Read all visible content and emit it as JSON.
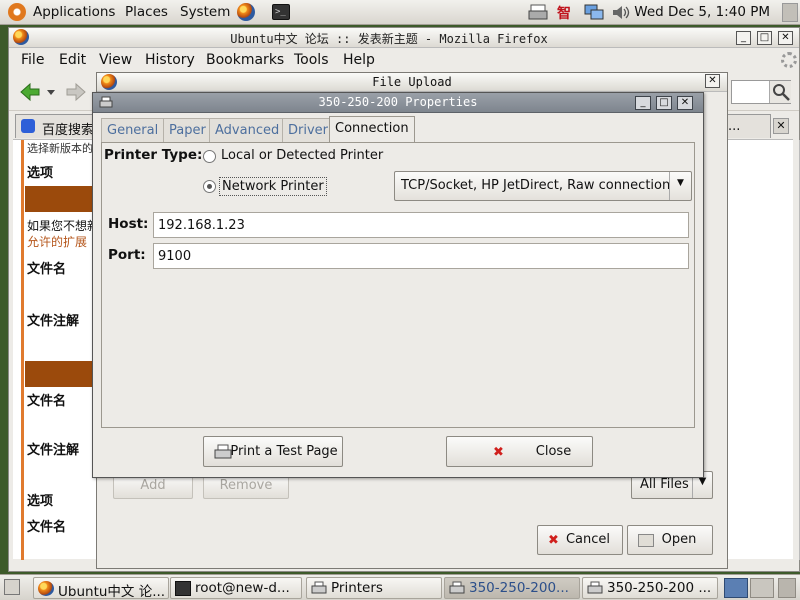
{
  "top_panel": {
    "menus": [
      "Applications",
      "Places",
      "System"
    ],
    "clock": "Wed Dec  5,  1:40 PM",
    "tray_cjk_label": "智"
  },
  "firefox": {
    "title": "Ubuntu中文 论坛 :: 发表新主题 - Mozilla Firefox",
    "menu": [
      "File",
      "Edit",
      "View",
      "History",
      "Bookmarks",
      "Tools",
      "Help"
    ],
    "tab_label": "百度搜索",
    "tab_more": "...",
    "content": {
      "line1": "选择新版本的",
      "row_xuanxiang": "选项",
      "note_line1": "如果您不想新",
      "note_line2": "允许的扩展",
      "filename": "文件名",
      "file_comment": "文件注解",
      "filename2": "文件名",
      "file_comment2": "文件注解",
      "row_xuanxiang2": "选项",
      "filename3": "文件名"
    }
  },
  "file_upload": {
    "title": "File Upload",
    "add_button": "Add",
    "remove_button": "Remove",
    "filter": "All Files",
    "cancel_button": "Cancel",
    "open_button": "Open"
  },
  "properties": {
    "title": "350-250-200 Properties",
    "tabs": [
      "General",
      "Paper",
      "Advanced",
      "Driver",
      "Connection"
    ],
    "active_tab": "Connection",
    "printer_type_label": "Printer Type:",
    "option_local": "Local or Detected Printer",
    "option_network": "Network Printer",
    "selected_option": "Network Printer",
    "connection_type": "TCP/Socket, HP JetDirect, Raw connection",
    "host_label": "Host:",
    "host_value": "192.168.1.23",
    "port_label": "Port:",
    "port_value": "9100",
    "test_page_button": "Print a Test Page",
    "close_button": "Close"
  },
  "taskbar": {
    "items": [
      "Ubuntu中文 论...",
      "root@new-d...",
      "Printers",
      "350-250-200...",
      "350-250-200 ..."
    ],
    "active_index": 3
  },
  "colors": {
    "forum_bar": "#9b4a0c",
    "link": "#b5561b",
    "active_task_text": "#2c4f8a"
  }
}
